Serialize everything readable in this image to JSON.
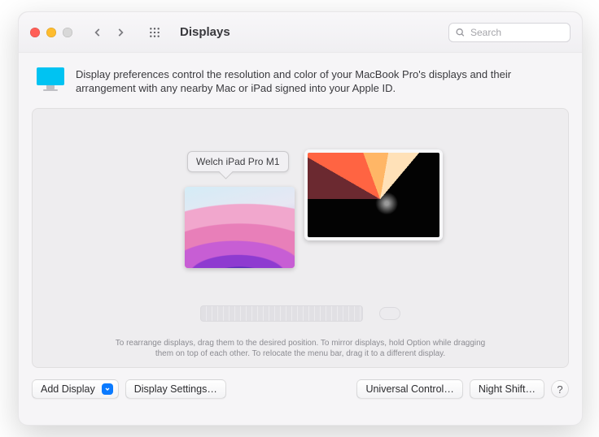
{
  "titlebar": {
    "title": "Displays",
    "search_placeholder": "Search"
  },
  "intro": {
    "text": "Display preferences control the resolution and color of your MacBook Pro's displays and their arrangement with any nearby Mac or iPad signed into your Apple ID."
  },
  "arrangement": {
    "tooltip_label": "Welch iPad Pro M1",
    "hint_line1": "To rearrange displays, drag them to the desired position. To mirror displays, hold Option while dragging",
    "hint_line2": "them on top of each other. To relocate the menu bar, drag it to a different display."
  },
  "footer": {
    "add_display": "Add Display",
    "display_settings": "Display Settings…",
    "universal_control": "Universal Control…",
    "night_shift": "Night Shift…",
    "help": "?"
  }
}
